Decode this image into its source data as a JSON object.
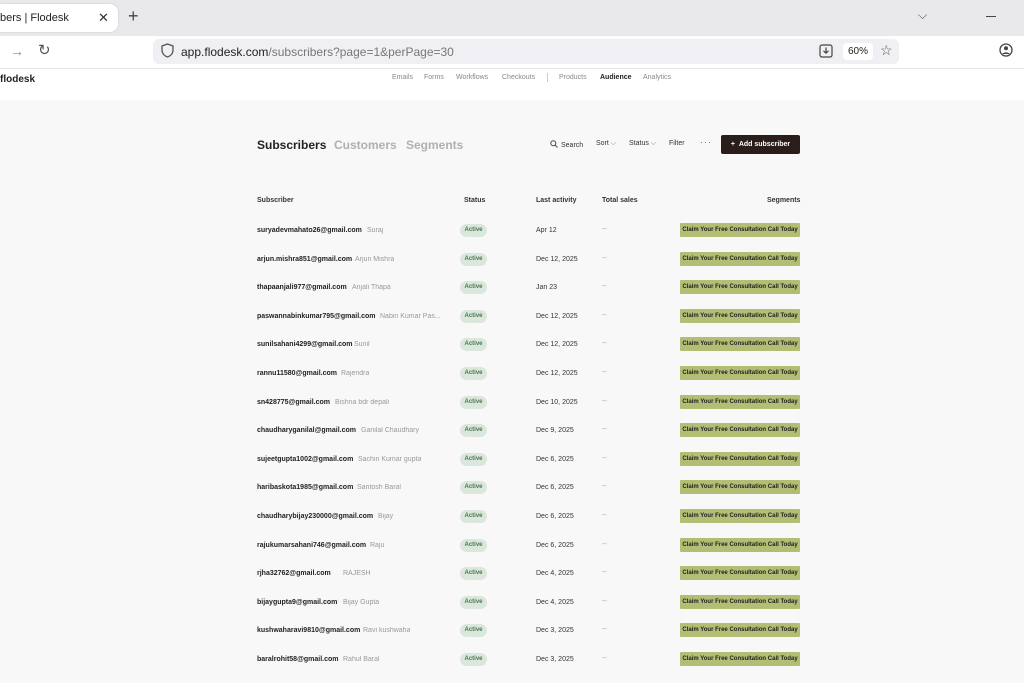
{
  "browser": {
    "tab_title": "bers | Flodesk",
    "url_host": "app.flodesk.com",
    "url_path": "/subscribers?page=1&perPage=30",
    "zoom": "60%"
  },
  "app": {
    "logo": "flodesk",
    "nav": [
      "Emails",
      "Forms",
      "Workflows",
      "Checkouts",
      "Products",
      "Audience",
      "Analytics"
    ]
  },
  "main": {
    "tabs": [
      "Subscribers",
      "Customers",
      "Segments"
    ],
    "tools": {
      "search": "Search",
      "sort": "Sort",
      "status": "Status",
      "filter": "Filter",
      "more": "···"
    },
    "add_button": "Add subscriber",
    "columns": [
      "Subscriber",
      "Status",
      "Last activity",
      "Total sales",
      "Segments"
    ]
  },
  "rows": [
    {
      "email": "suryadevmahato26@gmail.com",
      "name": "Suraj",
      "status": "Active",
      "last": "Apr 12",
      "sales": "--",
      "segment": "Claim Your Free Consultation Call Today"
    },
    {
      "email": "arjun.mishra851@gmail.com",
      "name": "Arjun Mishra",
      "status": "Active",
      "last": "Dec 12, 2025",
      "sales": "--",
      "segment": "Claim Your Free Consultation Call Today"
    },
    {
      "email": "thapaanjali977@gmail.com",
      "name": "Anjali Thapa",
      "status": "Active",
      "last": "Jan 23",
      "sales": "--",
      "segment": "Claim Your Free Consultation Call Today"
    },
    {
      "email": "paswannabinkumar795@gmail.com",
      "name": "Nabin Kumar Pas...",
      "status": "Active",
      "last": "Dec 12, 2025",
      "sales": "--",
      "segment": "Claim Your Free Consultation Call Today"
    },
    {
      "email": "sunilsahani4299@gmail.com",
      "name": "Sunil",
      "status": "Active",
      "last": "Dec 12, 2025",
      "sales": "--",
      "segment": "Claim Your Free Consultation Call Today"
    },
    {
      "email": "rannu11580@gmail.com",
      "name": "Rajendra",
      "status": "Active",
      "last": "Dec 12, 2025",
      "sales": "--",
      "segment": "Claim Your Free Consultation Call Today"
    },
    {
      "email": "sn428775@gmail.com",
      "name": "Bishna bdr depali",
      "status": "Active",
      "last": "Dec 10, 2025",
      "sales": "--",
      "segment": "Claim Your Free Consultation Call Today"
    },
    {
      "email": "chaudharyganilal@gmail.com",
      "name": "Ganilal Chaudhary",
      "status": "Active",
      "last": "Dec 9, 2025",
      "sales": "--",
      "segment": "Claim Your Free Consultation Call Today"
    },
    {
      "email": "sujeetgupta1002@gmail.com",
      "name": "Sachin Kumar gupta",
      "status": "Active",
      "last": "Dec 6, 2025",
      "sales": "--",
      "segment": "Claim Your Free Consultation Call Today"
    },
    {
      "email": "haribaskota1985@gmail.com",
      "name": "Santosh Baral",
      "status": "Active",
      "last": "Dec 6, 2025",
      "sales": "--",
      "segment": "Claim Your Free Consultation Call Today"
    },
    {
      "email": "chaudharybijay230000@gmail.com",
      "name": "Bijay",
      "status": "Active",
      "last": "Dec 6, 2025",
      "sales": "--",
      "segment": "Claim Your Free Consultation Call Today"
    },
    {
      "email": "rajukumarsahani746@gmail.com",
      "name": "Raju",
      "status": "Active",
      "last": "Dec 6, 2025",
      "sales": "--",
      "segment": "Claim Your Free Consultation Call Today"
    },
    {
      "email": "rjha32762@gmail.com",
      "name": "RAJESH",
      "status": "Active",
      "last": "Dec 4, 2025",
      "sales": "--",
      "segment": "Claim Your Free Consultation Call Today"
    },
    {
      "email": "bijaygupta9@gmail.com",
      "name": "Bijay Gupta",
      "status": "Active",
      "last": "Dec 4, 2025",
      "sales": "--",
      "segment": "Claim Your Free Consultation Call Today"
    },
    {
      "email": "kushwaharavi9810@gmail.com",
      "name": "Ravi kushwaha",
      "status": "Active",
      "last": "Dec 3, 2025",
      "sales": "--",
      "segment": "Claim Your Free Consultation Call Today"
    },
    {
      "email": "baralrohit58@gmail.com",
      "name": "Rahul Baral",
      "status": "Active",
      "last": "Dec 3, 2025",
      "sales": "--",
      "segment": "Claim Your Free Consultation Call Today"
    }
  ]
}
